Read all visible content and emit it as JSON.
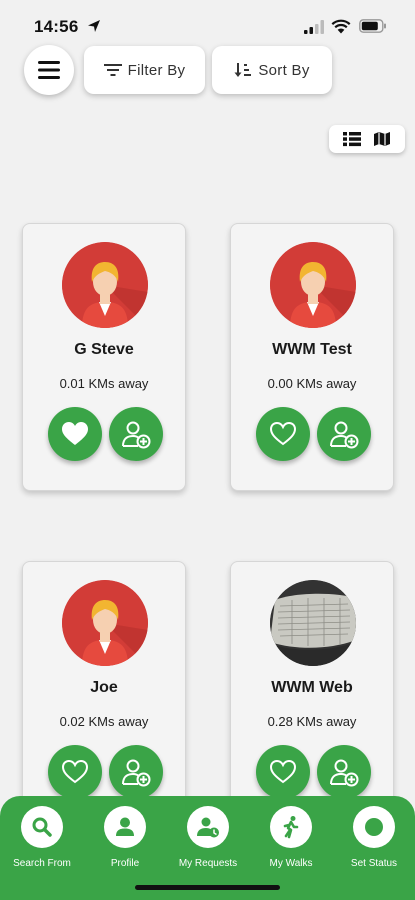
{
  "status_bar": {
    "time": "14:56"
  },
  "toolbar": {
    "menu_icon": "hamburger-icon",
    "filter_label": "Filter By",
    "sort_label": "Sort By"
  },
  "view_toggle": {
    "options": [
      "list",
      "map"
    ],
    "selected": "list"
  },
  "cards": [
    {
      "name": "G Steve",
      "distance": "0.01 KMs away",
      "avatar": "default-avatar",
      "favorited": true
    },
    {
      "name": "WWM Test",
      "distance": "0.00 KMs away",
      "avatar": "default-avatar",
      "favorited": false
    },
    {
      "name": "Joe",
      "distance": "0.02 KMs away",
      "avatar": "default-avatar",
      "favorited": false
    },
    {
      "name": "WWM Web",
      "distance": "0.28 KMs away",
      "avatar": "photo-avatar",
      "favorited": false
    }
  ],
  "bottom_nav": {
    "items": [
      {
        "label": "Search From",
        "icon": "search-icon"
      },
      {
        "label": "Profile",
        "icon": "person-icon"
      },
      {
        "label": "My Requests",
        "icon": "requests-icon"
      },
      {
        "label": "My Walks",
        "icon": "walk-icon"
      },
      {
        "label": "Set Status",
        "icon": "status-icon"
      }
    ]
  },
  "colors": {
    "accent": "#3aa447",
    "avatar_bg": "#d23c37",
    "background": "#f1f1f1"
  }
}
